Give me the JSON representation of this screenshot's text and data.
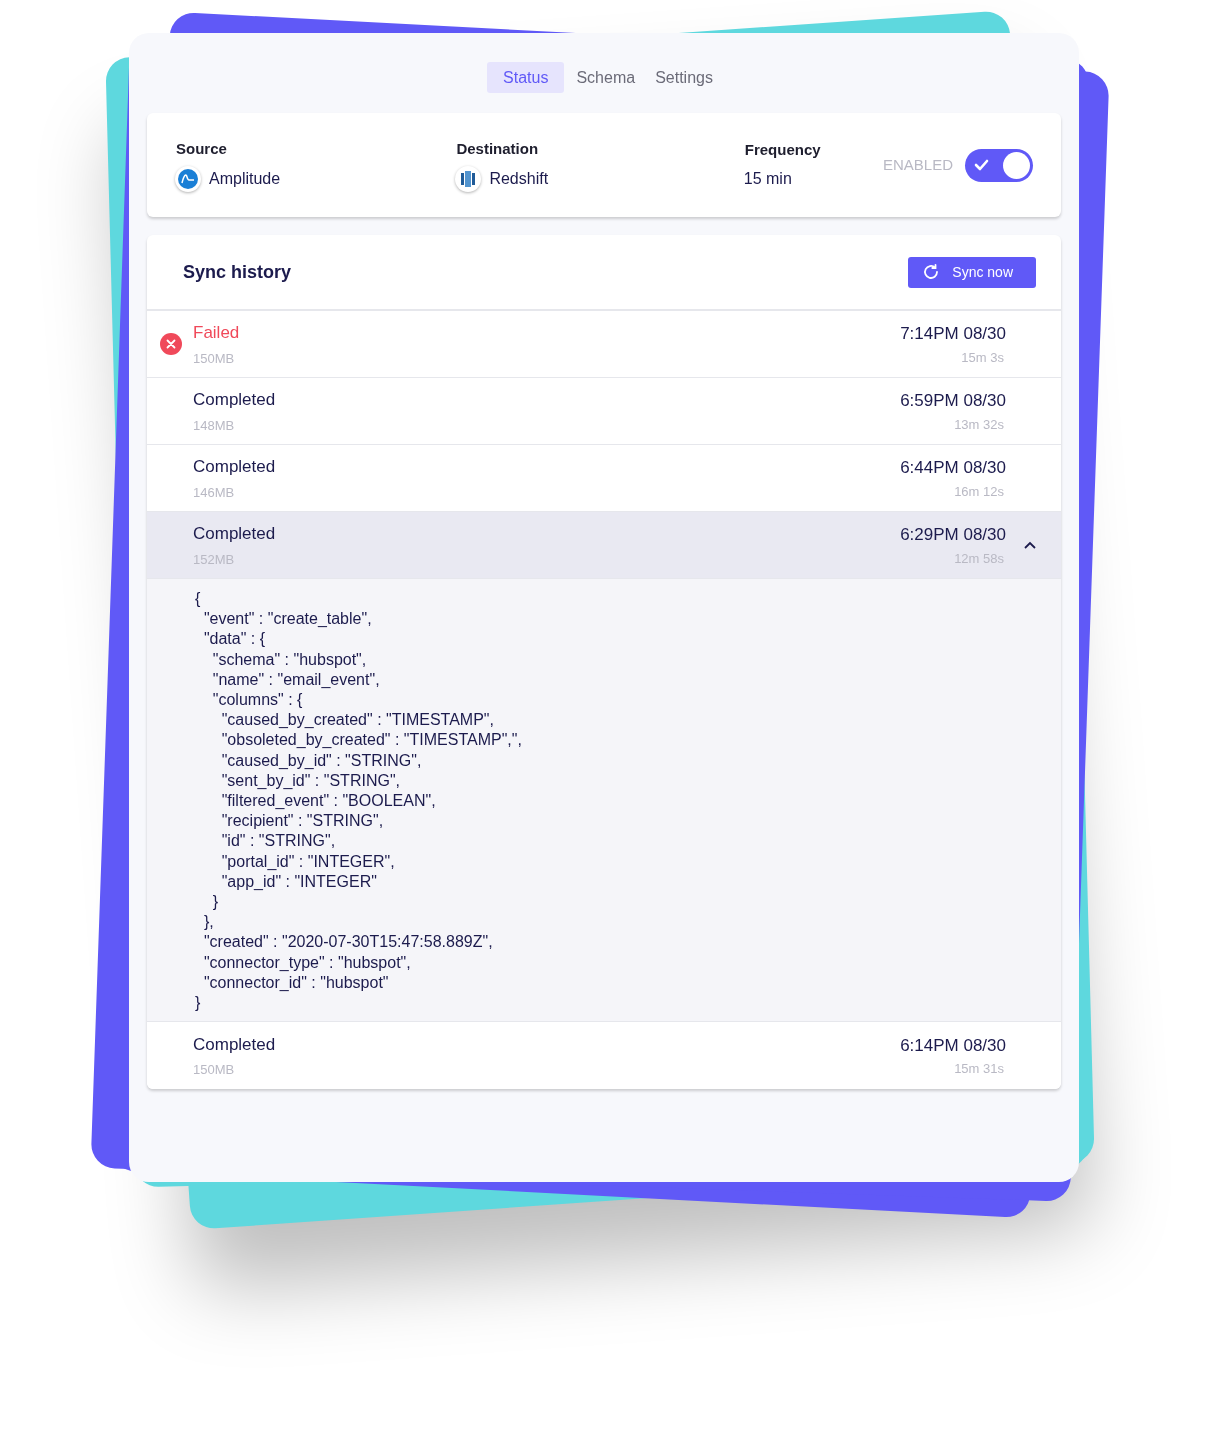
{
  "tabs": [
    {
      "label": "Status",
      "selected": true
    },
    {
      "label": "Schema",
      "selected": false
    },
    {
      "label": "Settings",
      "selected": false
    }
  ],
  "connection": {
    "source": {
      "label": "Source",
      "value": "Amplitude"
    },
    "destination": {
      "label": "Destination",
      "value": "Redshift"
    },
    "frequency": {
      "label": "Frequency",
      "value": "15 min"
    },
    "toggle": {
      "label": "ENABLED",
      "on": true
    }
  },
  "sync_history": {
    "title": "Sync history",
    "button": "Sync now",
    "rows": [
      {
        "kind": "failed",
        "status": "Failed",
        "size": "150MB",
        "time": "7:14PM 08/30",
        "duration": "15m 3s",
        "expanded": false
      },
      {
        "kind": "completed",
        "status": "Completed",
        "size": "148MB",
        "time": "6:59PM 08/30",
        "duration": "13m 32s",
        "expanded": false
      },
      {
        "kind": "completed",
        "status": "Completed",
        "size": "146MB",
        "time": "6:44PM 08/30",
        "duration": "16m 12s",
        "expanded": false
      },
      {
        "kind": "completed",
        "status": "Completed",
        "size": "152MB",
        "time": "6:29PM 08/30",
        "duration": "12m 58s",
        "expanded": true,
        "payload": "{\n  \"event\" : \"create_table\",\n  \"data\" : {\n    \"schema\" : \"hubspot\",\n    \"name\" : \"email_event\",\n    \"columns\" : {\n      \"caused_by_created\" : \"TIMESTAMP\",\n      \"obsoleted_by_created\" : \"TIMESTAMP\",\",\n      \"caused_by_id\" : \"STRING\",\n      \"sent_by_id\" : \"STRING\",\n      \"filtered_event\" : \"BOOLEAN\",\n      \"recipient\" : \"STRING\",\n      \"id\" : \"STRING\",\n      \"portal_id\" : \"INTEGER\",\n      \"app_id\" : \"INTEGER\"\n    }\n  },\n  \"created\" : \"2020-07-30T15:47:58.889Z\",\n  \"connector_type\" : \"hubspot\",\n  \"connector_id\" : \"hubspot\"\n}"
      },
      {
        "kind": "completed",
        "status": "Completed",
        "size": "150MB",
        "time": "6:14PM 08/30",
        "duration": "15m 31s",
        "expanded": false
      }
    ]
  }
}
